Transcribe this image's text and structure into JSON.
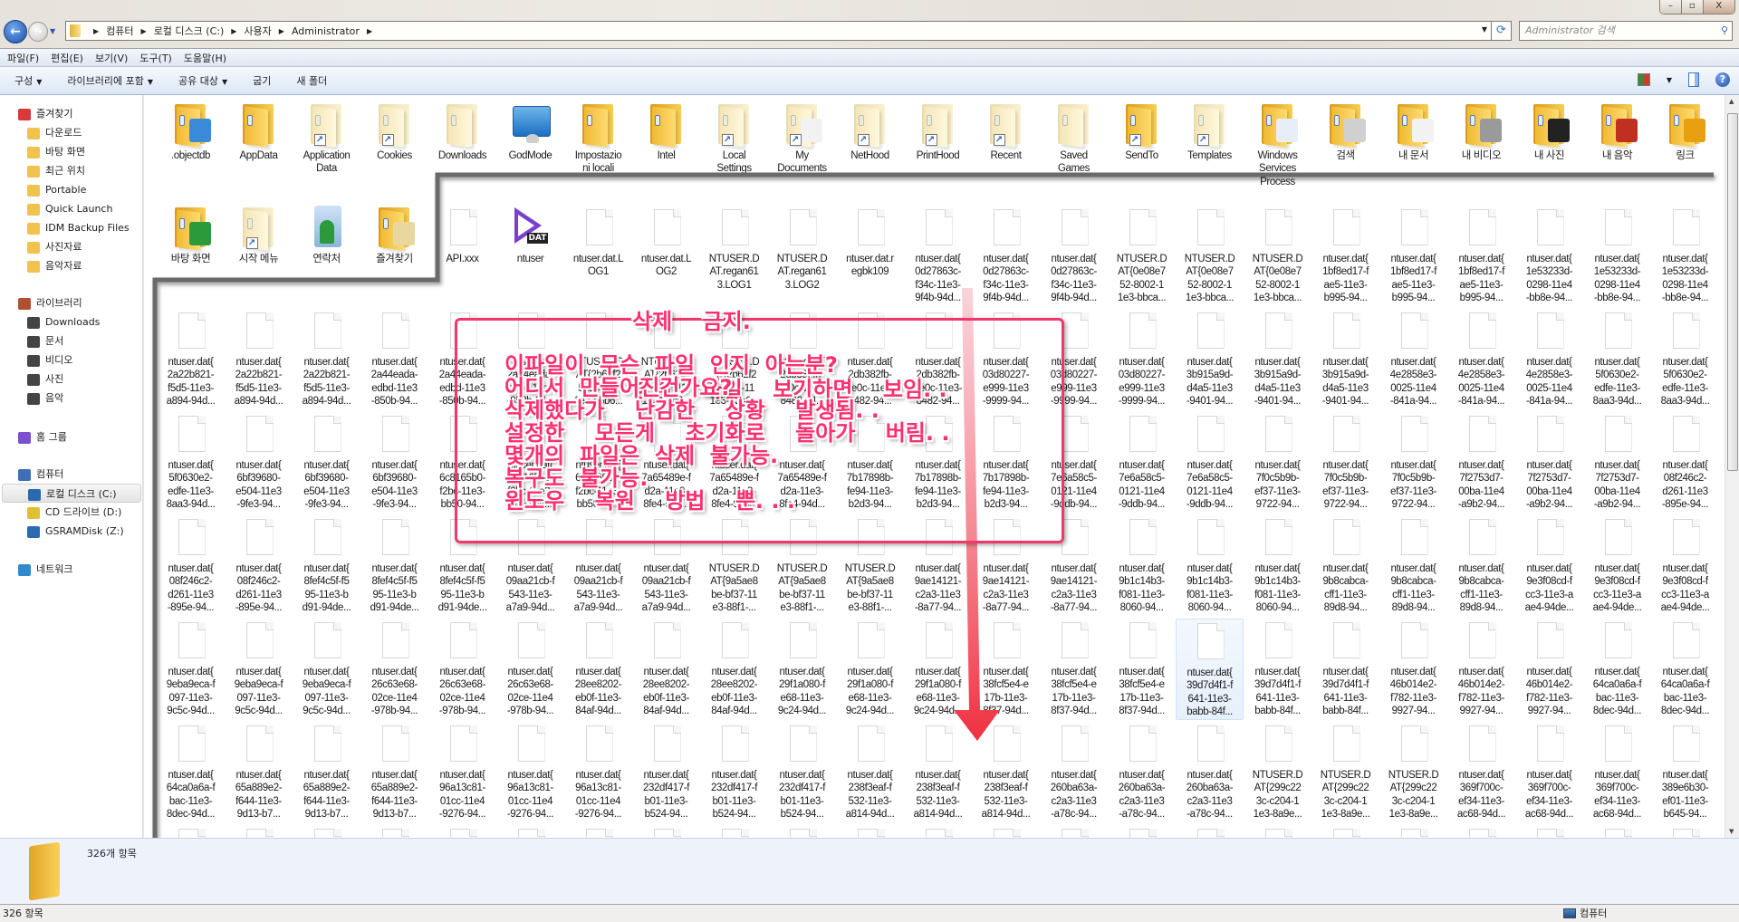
{
  "window": {
    "controls": [
      "–",
      "▫",
      "X"
    ]
  },
  "address": {
    "crumbs": [
      "컴퓨터",
      "로컬 디스크 (C:)",
      "사용자",
      "Administrator"
    ],
    "search_placeholder": "Administrator 검색"
  },
  "menu": [
    "파일(F)",
    "편집(E)",
    "보기(V)",
    "도구(T)",
    "도움말(H)"
  ],
  "toolbar": {
    "organize": "구성",
    "include_library": "라이브러리에 포함",
    "share_with": "공유 대상",
    "burn": "굽기",
    "new_folder": "새 폴더"
  },
  "sidebar": {
    "favorites": {
      "label": "즐겨찾기",
      "items": [
        "다운로드",
        "바탕 화면",
        "최근 위치",
        "Portable",
        "Quick Launch",
        "IDM Backup Files",
        "사진자료",
        "음악자료"
      ]
    },
    "libraries": {
      "label": "라이브러리",
      "items": [
        "Downloads",
        "문서",
        "비디오",
        "사진",
        "음악"
      ]
    },
    "homegroup": {
      "label": "홈 그룹"
    },
    "computer": {
      "label": "컴퓨터",
      "items": [
        "로컬 디스크 (C:)",
        "CD 드라이브 (D:)",
        "GSRAMDisk (Z:)"
      ],
      "selected": "로컬 디스크 (C:)"
    },
    "network": {
      "label": "네트워크"
    }
  },
  "content": {
    "hovered_label": "ntuser.dat{\n39d7d4f1-f\n641-11e3-\nbabb-84f...",
    "items": [
      {
        "label": ".objectdb",
        "icon": "folder-doc"
      },
      {
        "label": "AppData",
        "icon": "folder"
      },
      {
        "label": "Application\nData",
        "icon": "folder-shortcut",
        "hidden": true
      },
      {
        "label": "Cookies",
        "icon": "folder-shortcut",
        "hidden": true
      },
      {
        "label": "Downloads",
        "icon": "folder",
        "hidden": true
      },
      {
        "label": "GodMode",
        "icon": "control-panel"
      },
      {
        "label": "Impostazio\nni locali",
        "icon": "folder"
      },
      {
        "label": "Intel",
        "icon": "folder"
      },
      {
        "label": "Local\nSettings",
        "icon": "folder-shortcut",
        "hidden": true
      },
      {
        "label": "My\nDocuments",
        "icon": "folder-docs-shortcut",
        "hidden": true
      },
      {
        "label": "NetHood",
        "icon": "folder-shortcut",
        "hidden": true
      },
      {
        "label": "PrintHood",
        "icon": "folder-shortcut",
        "hidden": true
      },
      {
        "label": "Recent",
        "icon": "folder-shortcut",
        "hidden": true
      },
      {
        "label": "Saved\nGames",
        "icon": "folder",
        "hidden": true
      },
      {
        "label": "SendTo",
        "icon": "folder-shortcut"
      },
      {
        "label": "Templates",
        "icon": "folder-shortcut",
        "hidden": true
      },
      {
        "label": "Windows\nServices\nProcess",
        "icon": "folder-window"
      },
      {
        "label": "검색",
        "icon": "folder-search"
      },
      {
        "label": "내 문서",
        "icon": "folder-docs"
      },
      {
        "label": "내 비디오",
        "icon": "folder-video"
      },
      {
        "label": "내 사진",
        "icon": "folder-camera"
      },
      {
        "label": "내 음악",
        "icon": "folder-guitar"
      },
      {
        "label": "링크",
        "icon": "folder-link"
      },
      {
        "label": "바탕 화면",
        "icon": "folder-desktop"
      },
      {
        "label": "시작 메뉴",
        "icon": "folder-shortcut",
        "hidden": true
      },
      {
        "label": "연락처",
        "icon": "contacts"
      },
      {
        "label": "즐겨찾기",
        "icon": "folder-star"
      },
      {
        "label": "API.xxx",
        "icon": "file"
      },
      {
        "label": "ntuser",
        "icon": "dat-player",
        "badge": "DAT"
      },
      "ntuser.dat.L\nOG1",
      "ntuser.dat.L\nOG2",
      "NTUSER.D\nAT.regan61\n3.LOG1",
      "NTUSER.D\nAT.regan61\n3.LOG2",
      "ntuser.dat.r\negbk109",
      "ntuser.dat{\n0d27863c-\nf34c-11e3-\n9f4b-94d...",
      "ntuser.dat{\n0d27863c-\nf34c-11e3-\n9f4b-94d...",
      "ntuser.dat{\n0d27863c-\nf34c-11e3-\n9f4b-94d...",
      "NTUSER.D\nAT{0e08e7\n52-8002-1\n1e3-bbca...",
      "NTUSER.D\nAT{0e08e7\n52-8002-1\n1e3-bbca...",
      "NTUSER.D\nAT{0e08e7\n52-8002-1\n1e3-bbca...",
      "ntuser.dat{\n1bf8ed17-f\nae5-11e3-\nb995-94...",
      "ntuser.dat{\n1bf8ed17-f\nae5-11e3-\nb995-94...",
      "ntuser.dat{\n1bf8ed17-f\nae5-11e3-\nb995-94...",
      "ntuser.dat{\n1e53233d-\n0298-11e4\n-bb8e-94...",
      "ntuser.dat{\n1e53233d-\n0298-11e4\n-bb8e-94...",
      "ntuser.dat{\n1e53233d-\n0298-11e4\n-bb8e-94...",
      "ntuser.dat{\n2a22b821-\nf5d5-11e3-\na894-94d...",
      "ntuser.dat{\n2a22b821-\nf5d5-11e3-\na894-94d...",
      "ntuser.dat{\n2a22b821-\nf5d5-11e3-\na894-94d...",
      "ntuser.dat{\n2a44eada-\nedbd-11e3\n-850b-94...",
      "ntuser.dat{\n2a44eada-\nedbd-11e3\n-850b-94...",
      "ntuser.dat{\n2a44eada-\nedbd-11e3\n-850b-94...",
      "NTUSER.D\nAT{2b62f2\n5-f297-11\n1e3-b5b6...",
      "NTUSER.D\nAT{2b62f2\n5-f297-11\n1e3-b5b6...",
      "NTUSER.D\nAT{2b62f2\n5-f297-11\n1e3-b5b6...",
      "ntuser.dat{\n2db382fb-\nee0c-11e3-\n8482-94...",
      "ntuser.dat{\n2db382fb-\nee0c-11e3-\n8482-94...",
      "ntuser.dat{\n2db382fb-\nee0c-11e3-\n8482-94...",
      "ntuser.dat{\n03d80227-\ne999-11e3\n-9999-94...",
      "ntuser.dat{\n03d80227-\ne999-11e3\n-9999-94...",
      "ntuser.dat{\n03d80227-\ne999-11e3\n-9999-94...",
      "ntuser.dat{\n3b915a9d-\nd4a5-11e3\n-9401-94...",
      "ntuser.dat{\n3b915a9d-\nd4a5-11e3\n-9401-94...",
      "ntuser.dat{\n3b915a9d-\nd4a5-11e3\n-9401-94...",
      "ntuser.dat{\n4e2858e3-\n0025-11e4\n-841a-94...",
      "ntuser.dat{\n4e2858e3-\n0025-11e4\n-841a-94...",
      "ntuser.dat{\n4e2858e3-\n0025-11e4\n-841a-94...",
      "ntuser.dat{\n5f0630e2-\nedfe-11e3-\n8aa3-94d...",
      "ntuser.dat{\n5f0630e2-\nedfe-11e3-\n8aa3-94d...",
      "ntuser.dat{\n5f0630e2-\nedfe-11e3-\n8aa3-94d...",
      "ntuser.dat{\n6bf39680-\ne504-11e3\n-9fe3-94...",
      "ntuser.dat{\n6bf39680-\ne504-11e3\n-9fe3-94...",
      "ntuser.dat{\n6bf39680-\ne504-11e3\n-9fe3-94...",
      "ntuser.dat{\n6c8165b0-\nf2bc-11e3-\nbb50-94...",
      "ntuser.dat{\n6c8165b0-\nf2bc-11e3-\nbb50-94...",
      "ntuser.dat{\n6c8165b0-\nf2bc-11e3-\nbb50-94...",
      "ntuser.dat{\n7a65489e-f\nd2a-11e3-\n8fe4-94d...",
      "ntuser.dat{\n7a65489e-f\nd2a-11e3-\n8fe4-94d...",
      "ntuser.dat{\n7a65489e-f\nd2a-11e3-\n8fe4-94d...",
      "ntuser.dat{\n7b17898b-\nfe94-11e3-\nb2d3-94...",
      "ntuser.dat{\n7b17898b-\nfe94-11e3-\nb2d3-94...",
      "ntuser.dat{\n7b17898b-\nfe94-11e3-\nb2d3-94...",
      "ntuser.dat{\n7e6a58c5-\n0121-11e4\n-9ddb-94...",
      "ntuser.dat{\n7e6a58c5-\n0121-11e4\n-9ddb-94...",
      "ntuser.dat{\n7e6a58c5-\n0121-11e4\n-9ddb-94...",
      "ntuser.dat{\n7f0c5b9b-\nef37-11e3-\n9722-94...",
      "ntuser.dat{\n7f0c5b9b-\nef37-11e3-\n9722-94...",
      "ntuser.dat{\n7f0c5b9b-\nef37-11e3-\n9722-94...",
      "ntuser.dat{\n7f2753d7-\n00ba-11e4\n-a9b2-94...",
      "ntuser.dat{\n7f2753d7-\n00ba-11e4\n-a9b2-94...",
      "ntuser.dat{\n7f2753d7-\n00ba-11e4\n-a9b2-94...",
      "ntuser.dat{\n08f246c2-\nd261-11e3\n-895e-94...",
      "ntuser.dat{\n08f246c2-\nd261-11e3\n-895e-94...",
      "ntuser.dat{\n08f246c2-\nd261-11e3\n-895e-94...",
      "ntuser.dat{\n8fef4c5f-f5\n95-11e3-b\nd91-94de...",
      "ntuser.dat{\n8fef4c5f-f5\n95-11e3-b\nd91-94de...",
      "ntuser.dat{\n8fef4c5f-f5\n95-11e3-b\nd91-94de...",
      "ntuser.dat{\n09aa21cb-f\n543-11e3-\na7a9-94d...",
      "ntuser.dat{\n09aa21cb-f\n543-11e3-\na7a9-94d...",
      "ntuser.dat{\n09aa21cb-f\n543-11e3-\na7a9-94d...",
      "NTUSER.D\nAT{9a5ae8\nbe-bf37-11\ne3-88f1-...",
      "NTUSER.D\nAT{9a5ae8\nbe-bf37-11\ne3-88f1-...",
      "NTUSER.D\nAT{9a5ae8\nbe-bf37-11\ne3-88f1-...",
      "ntuser.dat{\n9ae14121-\nc2a3-11e3\n-8a77-94...",
      "ntuser.dat{\n9ae14121-\nc2a3-11e3\n-8a77-94...",
      "ntuser.dat{\n9ae14121-\nc2a3-11e3\n-8a77-94...",
      "ntuser.dat{\n9b1c14b3-\nf081-11e3-\n8060-94...",
      "ntuser.dat{\n9b1c14b3-\nf081-11e3-\n8060-94...",
      "ntuser.dat{\n9b1c14b3-\nf081-11e3-\n8060-94...",
      "ntuser.dat{\n9b8cabca-\ncff1-11e3-\n89d8-94...",
      "ntuser.dat{\n9b8cabca-\ncff1-11e3-\n89d8-94...",
      "ntuser.dat{\n9b8cabca-\ncff1-11e3-\n89d8-94...",
      "ntuser.dat{\n9e3f08cd-f\ncc3-11e3-a\nae4-94de...",
      "ntuser.dat{\n9e3f08cd-f\ncc3-11e3-a\nae4-94de...",
      "ntuser.dat{\n9e3f08cd-f\ncc3-11e3-a\nae4-94de...",
      "ntuser.dat{\n9eba9eca-f\n097-11e3-\n9c5c-94d...",
      "ntuser.dat{\n9eba9eca-f\n097-11e3-\n9c5c-94d...",
      "ntuser.dat{\n9eba9eca-f\n097-11e3-\n9c5c-94d...",
      "ntuser.dat{\n26c63e68-\n02ce-11e4\n-978b-94...",
      "ntuser.dat{\n26c63e68-\n02ce-11e4\n-978b-94...",
      "ntuser.dat{\n26c63e68-\n02ce-11e4\n-978b-94...",
      "ntuser.dat{\n28ee8202-\neb0f-11e3-\n84af-94d...",
      "ntuser.dat{\n28ee8202-\neb0f-11e3-\n84af-94d...",
      "ntuser.dat{\n28ee8202-\neb0f-11e3-\n84af-94d...",
      "ntuser.dat{\n29f1a080-f\ne68-11e3-\n9c24-94d...",
      "ntuser.dat{\n29f1a080-f\ne68-11e3-\n9c24-94d...",
      "ntuser.dat{\n29f1a080-f\ne68-11e3-\n9c24-94d...",
      "ntuser.dat{\n38fcf5e4-e\n17b-11e3-\n8f37-94d...",
      "ntuser.dat{\n38fcf5e4-e\n17b-11e3-\n8f37-94d...",
      "ntuser.dat{\n38fcf5e4-e\n17b-11e3-\n8f37-94d...",
      "ntuser.dat{\n39d7d4f1-f\n641-11e3-\nbabb-84f...",
      "ntuser.dat{\n39d7d4f1-f\n641-11e3-\nbabb-84f...",
      "ntuser.dat{\n39d7d4f1-f\n641-11e3-\nbabb-84f...",
      "ntuser.dat{\n46b014e2-\nf782-11e3-\n9927-94...",
      "ntuser.dat{\n46b014e2-\nf782-11e3-\n9927-94...",
      "ntuser.dat{\n46b014e2-\nf782-11e3-\n9927-94...",
      "ntuser.dat{\n64ca0a6a-f\nbac-11e3-\n8dec-94d...",
      "ntuser.dat{\n64ca0a6a-f\nbac-11e3-\n8dec-94d...",
      "ntuser.dat{\n64ca0a6a-f\nbac-11e3-\n8dec-94d...",
      "ntuser.dat{\n65a889e2-\nf644-11e3-\n9d13-b7...",
      "ntuser.dat{\n65a889e2-\nf644-11e3-\n9d13-b7...",
      "ntuser.dat{\n65a889e2-\nf644-11e3-\n9d13-b7...",
      "ntuser.dat{\n96a13c81-\n01cc-11e4\n-9276-94...",
      "ntuser.dat{\n96a13c81-\n01cc-11e4\n-9276-94...",
      "ntuser.dat{\n96a13c81-\n01cc-11e4\n-9276-94...",
      "ntuser.dat{\n232df417-f\nb01-11e3-\nb524-94...",
      "ntuser.dat{\n232df417-f\nb01-11e3-\nb524-94...",
      "ntuser.dat{\n232df417-f\nb01-11e3-\nb524-94...",
      "ntuser.dat{\n238f3eaf-f\n532-11e3-\na814-94d...",
      "ntuser.dat{\n238f3eaf-f\n532-11e3-\na814-94d...",
      "ntuser.dat{\n238f3eaf-f\n532-11e3-\na814-94d...",
      "ntuser.dat{\n260ba63a-\nc2a3-11e3\n-a78c-94...",
      "ntuser.dat{\n260ba63a-\nc2a3-11e3\n-a78c-94...",
      "ntuser.dat{\n260ba63a-\nc2a3-11e3\n-a78c-94...",
      "NTUSER.D\nAT{299c22\n3c-c204-1\n1e3-8a9e...",
      "NTUSER.D\nAT{299c22\n3c-c204-1\n1e3-8a9e...",
      "NTUSER.D\nAT{299c22\n3c-c204-1\n1e3-8a9e...",
      "ntuser.dat{\n369f700c-\nef34-11e3-\nac68-94d...",
      "ntuser.dat{\n369f700c-\nef34-11e3-\nac68-94d...",
      "ntuser.dat{\n369f700c-\nef34-11e3-\nac68-94d...",
      "ntuser.dat{\n389e6b30-\nef01-11e3-\nb645-94..."
    ]
  },
  "annotation": {
    "title_lines": [
      "삭제    금지.",
      "숨김    파일    보기하면    보임. ."
    ],
    "box_lines": [
      "이파일이  무슨  파일  인지  아는분?",
      "어디서  만들어진건가요?",
      "삭제했다가    난감한    상황    발생됨. .",
      "설정한    모든게    초기화로    돌아가    버림. .",
      "몇개의  파일은  삭제  불가능.",
      "복구도  불가능.",
      "윈도우    복원    방법    뿐. . ."
    ],
    "text_color": "#ff2f6f",
    "box_color": "#f0386b",
    "arrow_color": "#f03040"
  },
  "details": {
    "count": "326개 항목"
  },
  "status": {
    "count": "326 항목",
    "location": "컴퓨터"
  }
}
